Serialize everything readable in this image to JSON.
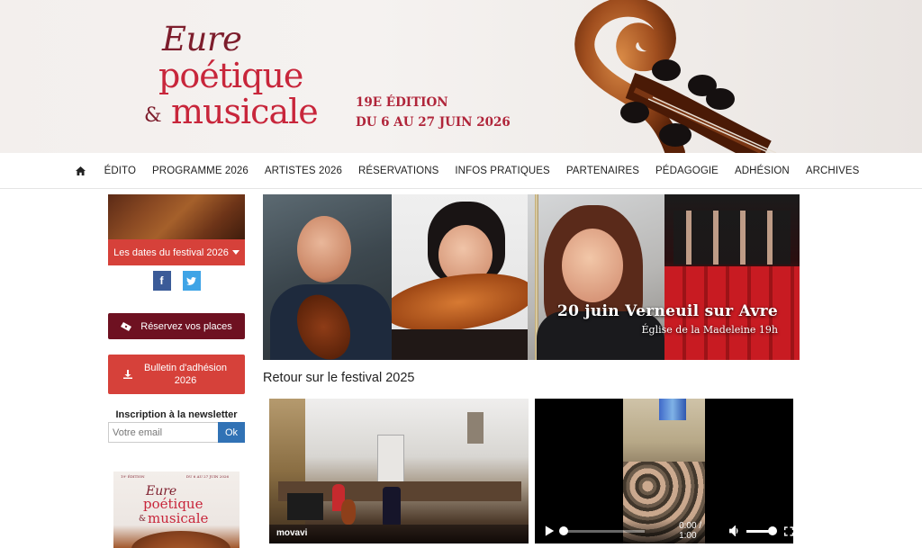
{
  "header": {
    "logo_eure": "Eure",
    "logo_poetique": "poétique",
    "logo_amp": "&",
    "logo_musicale": "musicale",
    "edition_line1": "19E ÉDITION",
    "edition_line2": "DU 6 AU 27 JUIN 2026"
  },
  "nav": {
    "home_icon": "home-icon",
    "items": [
      "ÉDITO",
      "PROGRAMME 2026",
      "ARTISTES 2026",
      "RÉSERVATIONS",
      "INFOS PRATIQUES",
      "PARTENAIRES",
      "PÉDAGOGIE",
      "ADHÉSION",
      "ARCHIVES"
    ]
  },
  "sidebar": {
    "dates_label": "Les dates du festival 2026",
    "facebook_glyph": "f",
    "reserve_label": "Réservez vos places",
    "bulletin_label": "Bulletin d'adhésion 2026",
    "newsletter_title": "Inscription à la newsletter",
    "newsletter_placeholder": "Votre email",
    "newsletter_button": "Ok",
    "poster": {
      "top_left": "19ᵉ ÉDITION",
      "top_right": "DU 6 AU 27 JUIN 2026",
      "eure": "Eure",
      "poetique": "poétique",
      "amp": "&",
      "musicale": "musicale"
    }
  },
  "banner": {
    "title": "20 juin Verneuil sur Avre",
    "subtitle": "Église de la Madeleine 19h"
  },
  "main": {
    "section_title": "Retour sur le festival 2025",
    "video1_watermark": "movavi",
    "video2_time": "0:00 / 1:00"
  },
  "colors": {
    "brand_red": "#d6413a",
    "brand_wine": "#6e1121",
    "newsletter_blue": "#3172b5",
    "facebook": "#3b5b98",
    "twitter": "#3fa4e6"
  }
}
